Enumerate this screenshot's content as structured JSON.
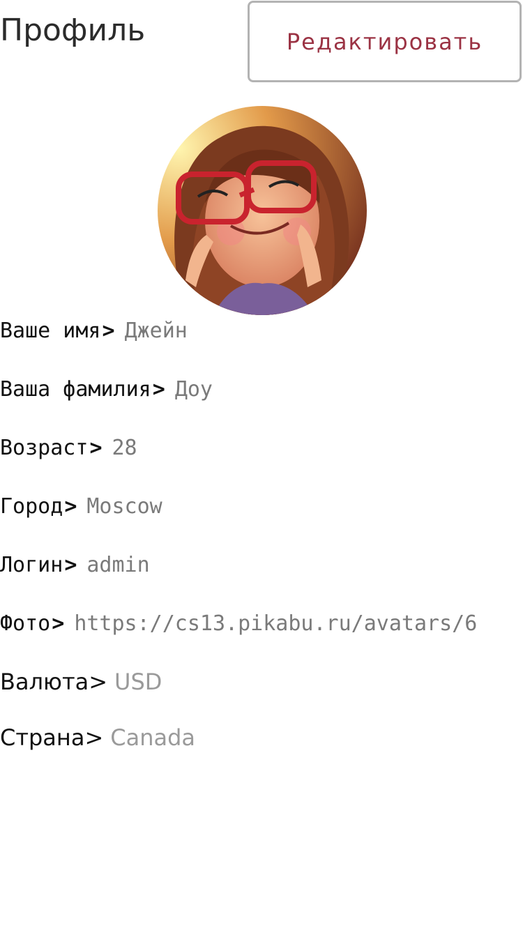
{
  "header": {
    "title": "Профиль",
    "edit_label": "Редактировать"
  },
  "avatar": {
    "icon": "avatar-photo"
  },
  "colors": {
    "accent": "#9b3344",
    "value_text": "#7a7a7a",
    "border": "#b3b3b3"
  },
  "fields": [
    {
      "label": "Ваше имя",
      "arrow": ">",
      "value": "Джейн"
    },
    {
      "label": "Ваша фамилия",
      "arrow": ">",
      "value": "Доу"
    },
    {
      "label": "Возраст",
      "arrow": ">",
      "value": "28"
    },
    {
      "label": "Город",
      "arrow": ">",
      "value": "Moscow"
    },
    {
      "label": "Логин",
      "arrow": ">",
      "value": "admin"
    },
    {
      "label": "Фото",
      "arrow": ">",
      "value": "https://cs13.pikabu.ru/avatars/6"
    },
    {
      "label": "Валюта",
      "arrow": ">",
      "value": "USD"
    },
    {
      "label": "Страна",
      "arrow": ">",
      "value": "Canada"
    }
  ]
}
